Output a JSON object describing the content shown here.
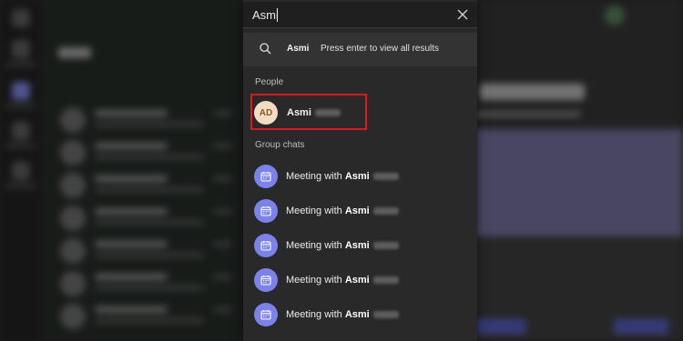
{
  "colors": {
    "accent": "#7b83eb",
    "highlight_box": "#e0181e",
    "avatar_bg": "#f3dcc2"
  },
  "search": {
    "value": "Asmi",
    "close_icon": "close-icon"
  },
  "hint": {
    "icon": "search-icon",
    "term": "Asmi",
    "text": "Press enter to view all results"
  },
  "people": {
    "section_label": "People",
    "items": [
      {
        "initials": "AD",
        "name": "Asmi",
        "name_redacted": true
      }
    ]
  },
  "group_chats": {
    "section_label": "Group chats",
    "icon": "calendar-icon",
    "items": [
      {
        "prefix": "Meeting with ",
        "name": "Asmi"
      },
      {
        "prefix": "Meeting with ",
        "name": "Asmi"
      },
      {
        "prefix": "Meeting with ",
        "name": "Asmi"
      },
      {
        "prefix": "Meeting with ",
        "name": "Asmi"
      },
      {
        "prefix": "Meeting with ",
        "name": "Asmi"
      }
    ]
  }
}
